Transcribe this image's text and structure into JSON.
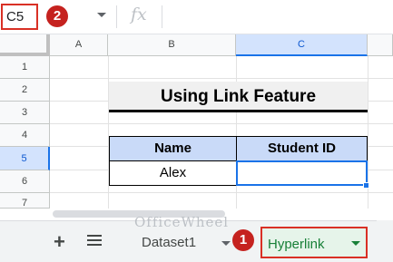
{
  "formula_bar": {
    "name_box": "C5",
    "fx_label": "fx",
    "formula": ""
  },
  "callouts": {
    "one": "1",
    "two": "2"
  },
  "columns": [
    "A",
    "B",
    "C"
  ],
  "rows": [
    "1",
    "2",
    "3",
    "4",
    "5",
    "6",
    "7"
  ],
  "selected_cell": "C5",
  "title": "Using Link Feature",
  "table": {
    "headers": [
      "Name",
      "Student ID"
    ],
    "rows": [
      [
        "Alex",
        ""
      ]
    ]
  },
  "sheet_tabs": {
    "add_label": "+",
    "tabs": [
      {
        "label": "Dataset1",
        "active": false
      },
      {
        "label": "Hyperlink",
        "active": true
      }
    ]
  },
  "watermark": "OfficeWheel",
  "colors": {
    "highlight_red": "#d93025",
    "selection_blue": "#1a73e8",
    "header_fill": "#c9daf8",
    "active_tab_green": "#188038"
  }
}
